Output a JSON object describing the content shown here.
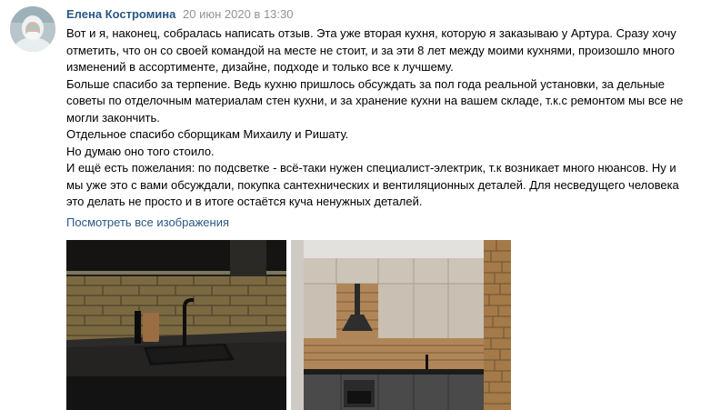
{
  "post": {
    "author": "Елена Костромина",
    "date": "20 июн 2020 в 13:30",
    "lines": [
      "Вот и я, наконец, собралась написать отзыв. Эта уже вторая кухня, которую я заказываю у Артура. Сразу хочу",
      "отметить, что он со своей командой на месте не стоит, и за эти 8 лет между моими кухнями, произошло много",
      "изменений в ассортименте, дизайне, подходе и только все к лучшему.",
      "Больше спасибо за терпение. Ведь кухню пришлось обсуждать за пол года реальной установки, за дельные",
      "советы по отделочным материалам стен кухни, и за хранение кухни на вашем складе, т.к.с ремонтом мы все не",
      "могли закончить.",
      "Отдельное спасибо сборщикам Михаилу и Ришату.",
      "Но думаю оно того стоило.",
      "И ещё есть пожелания: по подсветке - всё-таки нужен специалист-электрик, т.к возникает много нюансов. Ну и",
      "мы уже это с вами обсуждали, покупка сантехнических и вентиляционных деталей. Для несведущего человека",
      "это делать не просто и в итоге остаётся куча ненужных деталей."
    ],
    "view_all_label": "Посмотреть все изображения"
  },
  "colors": {
    "link": "#2a5885",
    "meta": "#939393",
    "text": "#000000"
  },
  "images": [
    {
      "name": "kitchen-sink-photo"
    },
    {
      "name": "kitchen-overview-photo"
    }
  ]
}
